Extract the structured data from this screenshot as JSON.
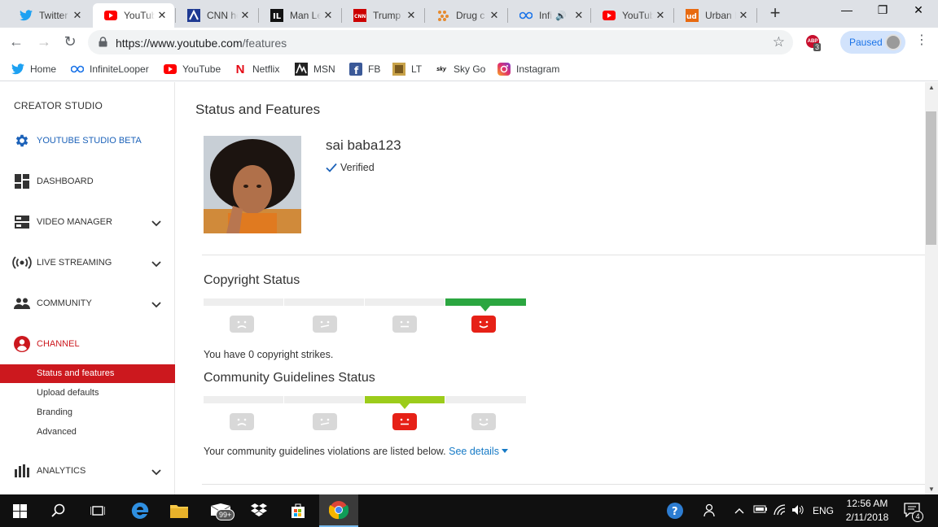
{
  "browser": {
    "tabs": [
      {
        "title": "Twitter",
        "icon": "twitter-icon",
        "color": "#1da1f2"
      },
      {
        "title": "YouTube",
        "icon": "youtube-icon",
        "color": "#ff0000",
        "active": true
      },
      {
        "title": "CNN health",
        "icon": "cnn-icon",
        "color": "#1f3a93"
      },
      {
        "title": "Man Le",
        "icon": "lt-icon",
        "color": "#111111"
      },
      {
        "title": "Trump",
        "icon": "cnn-icon",
        "color": "#cc0000"
      },
      {
        "title": "Drug c",
        "icon": "pattern-icon",
        "color": "#e68a2e"
      },
      {
        "title": "Infi",
        "icon": "infinite-looper-icon",
        "color": "#1a73e8"
      },
      {
        "title": "YouTube",
        "icon": "youtube-icon",
        "color": "#ff0000"
      },
      {
        "title": "Urban Dictionary",
        "icon": "urban-dictionary-icon",
        "color": "#e86a10"
      }
    ],
    "url_host": "https://www.youtube.com",
    "url_path": "/features",
    "abp_badge": "3",
    "profile_label": "Paused",
    "bookmarks": [
      {
        "label": "Home",
        "icon": "twitter-icon"
      },
      {
        "label": "InfiniteLooper",
        "icon": "infinite-looper-icon"
      },
      {
        "label": "YouTube",
        "icon": "youtube-icon"
      },
      {
        "label": "Netflix",
        "icon": "netflix-icon"
      },
      {
        "label": "MSN",
        "icon": "msn-icon"
      },
      {
        "label": "FB",
        "icon": "facebook-icon"
      },
      {
        "label": "LT",
        "icon": "lt-icon"
      },
      {
        "label": "Sky Go",
        "icon": "sky-go-icon"
      },
      {
        "label": "Instagram",
        "icon": "instagram-icon"
      }
    ]
  },
  "sidebar": {
    "header": "CREATOR STUDIO",
    "items": [
      {
        "label": "YOUTUBE STUDIO BETA",
        "icon": "gear-icon",
        "highlight": "blue"
      },
      {
        "label": "DASHBOARD",
        "icon": "dashboard-icon"
      },
      {
        "label": "VIDEO MANAGER",
        "icon": "video-manager-icon",
        "expandable": true
      },
      {
        "label": "LIVE STREAMING",
        "icon": "live-streaming-icon",
        "expandable": true
      },
      {
        "label": "COMMUNITY",
        "icon": "community-icon",
        "expandable": true
      },
      {
        "label": "CHANNEL",
        "icon": "channel-icon",
        "highlight": "red"
      }
    ],
    "channel_subitems": [
      "Status and features",
      "Upload defaults",
      "Branding",
      "Advanced"
    ],
    "analytics": {
      "label": "ANALYTICS",
      "icon": "analytics-icon"
    }
  },
  "main": {
    "title": "Status and Features",
    "channel_name": "sai baba123",
    "verified_label": "Verified",
    "copyright": {
      "title": "Copyright Status",
      "active_level": 4,
      "text": "You have 0 copyright strikes."
    },
    "community": {
      "title": "Community Guidelines Status",
      "active_level": 3,
      "text": "Your community guidelines violations are listed below.",
      "link": "See details"
    }
  },
  "taskbar": {
    "language": "ENG",
    "time": "12:56 AM",
    "date": "2/11/2018",
    "mail_badge": "99+",
    "notification_count": "4"
  },
  "colors": {
    "youtube_red": "#cc181e",
    "blue_link": "#167ac6",
    "green": "#2ba640",
    "lime": "#9ccc1b"
  }
}
